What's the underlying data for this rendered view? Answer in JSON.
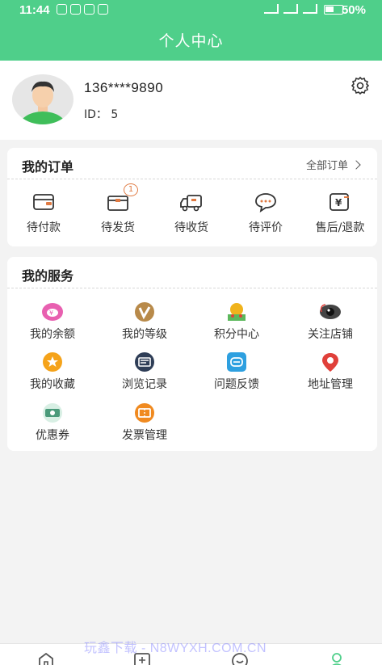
{
  "status_bar": {
    "time": "11:44",
    "battery": "50%",
    "battery_level": 0.5
  },
  "header": {
    "title": "个人中心"
  },
  "profile": {
    "phone": "136****9890",
    "id_text": "ID： 5",
    "settings_icon": "gear-icon",
    "avatar_icon": "user-avatar"
  },
  "orders": {
    "title": "我的订单",
    "all_label": "全部订单",
    "items": [
      {
        "label": "待付款",
        "icon": "wallet-icon"
      },
      {
        "label": "待发货",
        "icon": "box-icon",
        "badge": "1"
      },
      {
        "label": "待收货",
        "icon": "truck-icon"
      },
      {
        "label": "待评价",
        "icon": "comment-icon"
      },
      {
        "label": "售后/退款",
        "icon": "refund-icon"
      }
    ]
  },
  "services": {
    "title": "我的服务",
    "items": [
      {
        "label": "我的余额",
        "icon": "piggy-bank-icon",
        "color": "#e860b0"
      },
      {
        "label": "我的等级",
        "icon": "level-icon",
        "color": "#b88a4a"
      },
      {
        "label": "积分中心",
        "icon": "points-icon",
        "color": "#f0b31c"
      },
      {
        "label": "关注店铺",
        "icon": "eye-icon",
        "color": "#333333"
      },
      {
        "label": "我的收藏",
        "icon": "star-icon",
        "color": "#f5a31a"
      },
      {
        "label": "浏览记录",
        "icon": "history-icon",
        "color": "#2f3e57"
      },
      {
        "label": "问题反馈",
        "icon": "feedback-icon",
        "color": "#2ea0e0"
      },
      {
        "label": "地址管理",
        "icon": "location-icon",
        "color": "#e0403a"
      },
      {
        "label": "优惠券",
        "icon": "coupon-icon",
        "color": "#4a9a7a"
      },
      {
        "label": "发票管理",
        "icon": "invoice-icon",
        "color": "#f08a20"
      }
    ]
  },
  "bottom_nav": [
    {
      "icon": "home-icon"
    },
    {
      "icon": "category-icon"
    },
    {
      "icon": "message-icon"
    },
    {
      "icon": "user-icon",
      "active_color": "#4fcf8a"
    }
  ],
  "watermark": "玩鑫下载 - N8WYXH.COM.CN",
  "colors": {
    "brand": "#4fcf8a",
    "badge": "#e07a42"
  }
}
